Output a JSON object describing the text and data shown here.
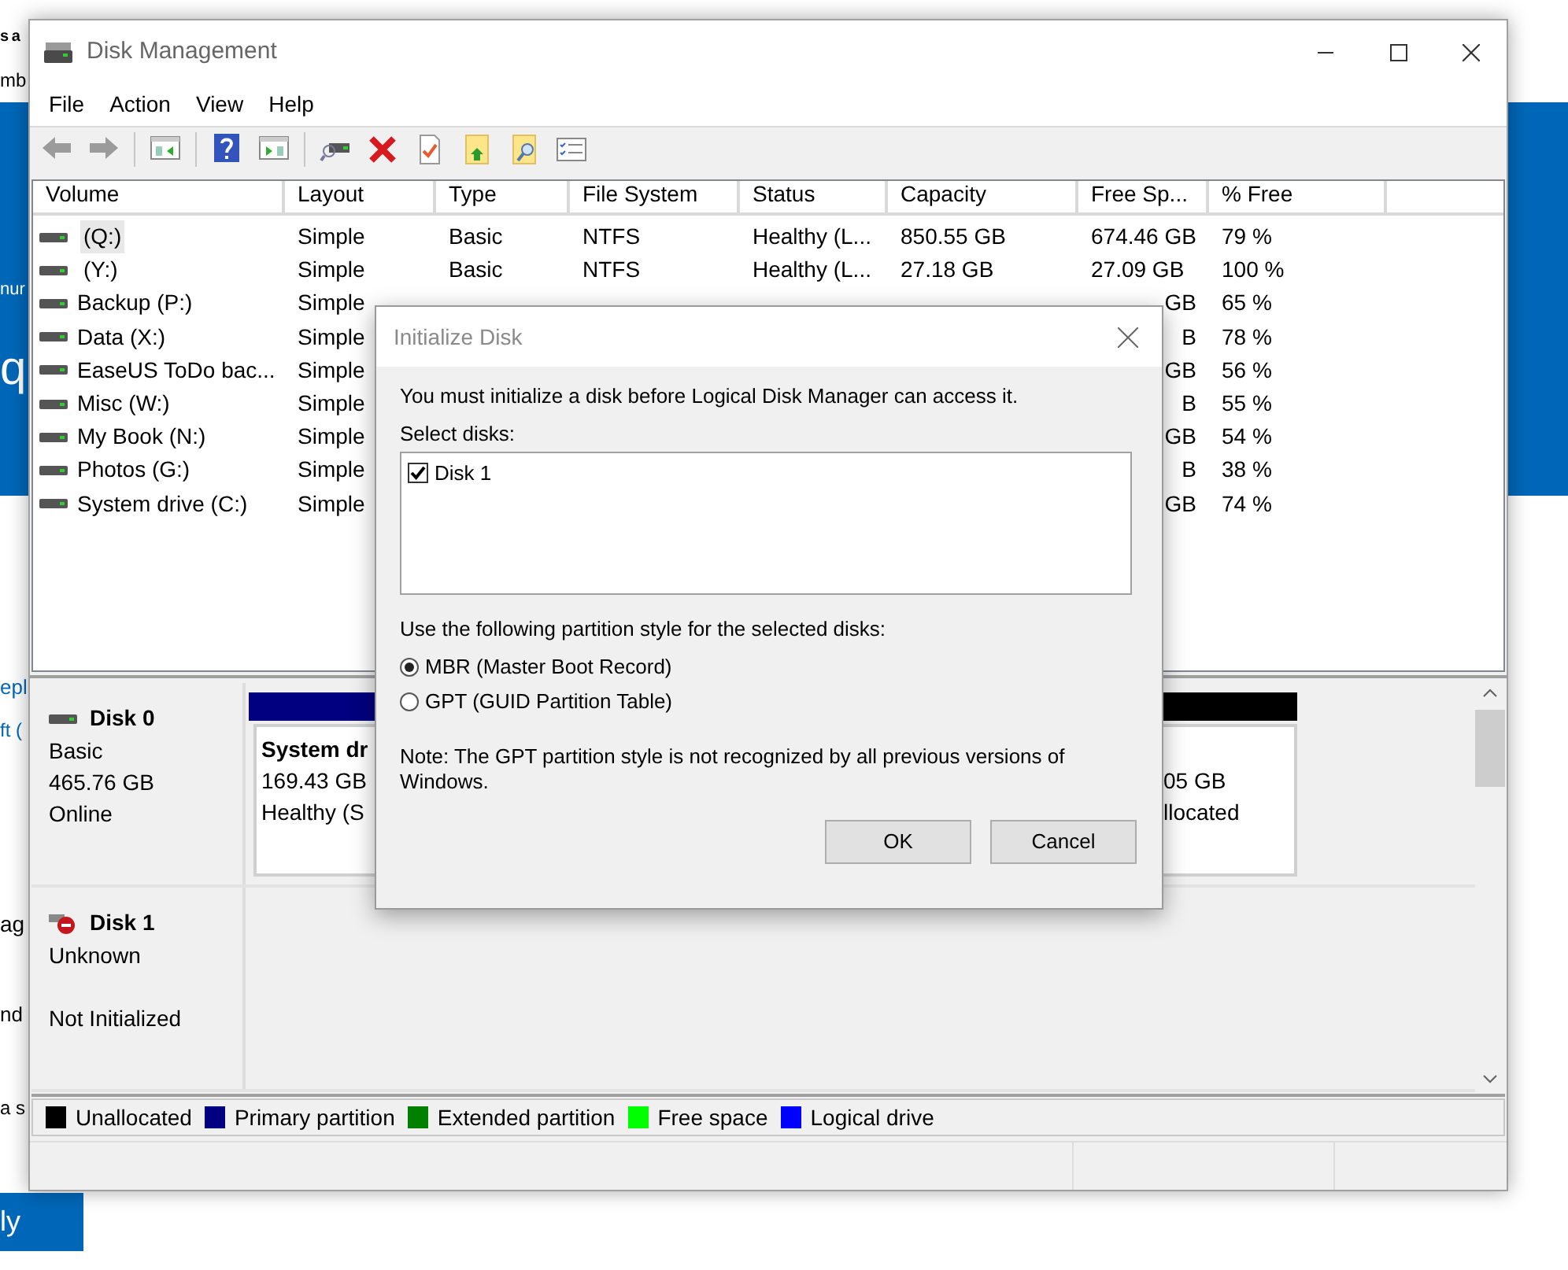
{
  "background_page": {
    "fragments": [
      {
        "text": "s a",
        "kind": "bold"
      },
      {
        "text": "mb",
        "kind": "plain"
      },
      {
        "text": "nur",
        "kind": "on_band"
      },
      {
        "text": "q",
        "kind": "big_on_band"
      },
      {
        "text": "epl",
        "kind": "link"
      },
      {
        "text": "ft (",
        "kind": "link"
      },
      {
        "text": "ag",
        "kind": "plain"
      },
      {
        "text": "nd",
        "kind": "plain"
      },
      {
        "text": "a s",
        "kind": "plain"
      }
    ],
    "button": {
      "label": "ly"
    }
  },
  "window": {
    "title": "Disk Management"
  },
  "menu": [
    "File",
    "Action",
    "View",
    "Help"
  ],
  "volumes": {
    "columns": [
      "Volume",
      "Layout",
      "Type",
      "File System",
      "Status",
      "Capacity",
      "Free Sp...",
      "% Free"
    ],
    "rows": [
      {
        "kind": "full",
        "selected": true,
        "volume": "(Q:)",
        "layout": "Simple",
        "type": "Basic",
        "file_system": "NTFS",
        "status": "Healthy (L...",
        "capacity": "850.55 GB",
        "free_space": "674.46 GB",
        "percent_free": "79 %"
      },
      {
        "kind": "full",
        "selected": false,
        "volume": "(Y:)",
        "layout": "Simple",
        "type": "Basic",
        "file_system": "NTFS",
        "status": "Healthy (L...",
        "capacity": "27.18 GB",
        "free_space": "27.09 GB",
        "percent_free": "100 %"
      },
      {
        "kind": "clipped",
        "selected": false,
        "volume": "Backup (P:)",
        "layout": "Simple",
        "free_space": "GB",
        "percent_free": "65 %"
      },
      {
        "kind": "clipped",
        "selected": false,
        "volume": "Data (X:)",
        "layout": "Simple",
        "free_space": "B",
        "percent_free": "78 %"
      },
      {
        "kind": "clipped",
        "selected": false,
        "volume": "EaseUS ToDo bac...",
        "layout": "Simple",
        "free_space": "GB",
        "percent_free": "56 %"
      },
      {
        "kind": "clipped",
        "selected": false,
        "volume": "Misc (W:)",
        "layout": "Simple",
        "free_space": "B",
        "percent_free": "55 %"
      },
      {
        "kind": "clipped",
        "selected": false,
        "volume": "My Book (N:)",
        "layout": "Simple",
        "free_space": "GB",
        "percent_free": "54 %"
      },
      {
        "kind": "clipped",
        "selected": false,
        "volume": "Photos (G:)",
        "layout": "Simple",
        "free_space": "B",
        "percent_free": "38 %"
      },
      {
        "kind": "clipped",
        "selected": false,
        "volume": "System drive (C:)",
        "layout": "Simple",
        "free_space": "GB",
        "percent_free": "74 %"
      }
    ]
  },
  "disks": [
    {
      "kind": "online",
      "name": "Disk 0",
      "lines": [
        "Basic",
        "465.76 GB",
        "Online"
      ],
      "partitions": [
        {
          "kind": "primary",
          "title": "System dr",
          "size": "169.43 GB",
          "status": "Healthy (S"
        },
        {
          "kind": "unallocated",
          "size": "05 GB",
          "status": "llocated"
        }
      ]
    },
    {
      "kind": "not_initialized",
      "name": "Disk 1",
      "lines": [
        "Unknown",
        "Not Initialized"
      ]
    }
  ],
  "legend": [
    {
      "label": "Unallocated",
      "color": "#000000"
    },
    {
      "label": "Primary partition",
      "color": "#000080"
    },
    {
      "label": "Extended partition",
      "color": "#008000"
    },
    {
      "label": "Free space",
      "color": "#00ff00"
    },
    {
      "label": "Logical drive",
      "color": "#0000ff"
    }
  ],
  "dialog": {
    "title": "Initialize Disk",
    "message": "You must initialize a disk before Logical Disk Manager can access it.",
    "select_label": "Select disks:",
    "disks": [
      {
        "label": "Disk 1",
        "checked": true
      }
    ],
    "style_label": "Use the following partition style for the selected disks:",
    "styles": [
      {
        "label": "MBR (Master Boot Record)",
        "selected": true
      },
      {
        "label": "GPT (GUID Partition Table)",
        "selected": false
      }
    ],
    "note": "Note: The GPT partition style is not recognized by all previous versions of Windows.",
    "buttons": [
      "OK",
      "Cancel"
    ]
  }
}
